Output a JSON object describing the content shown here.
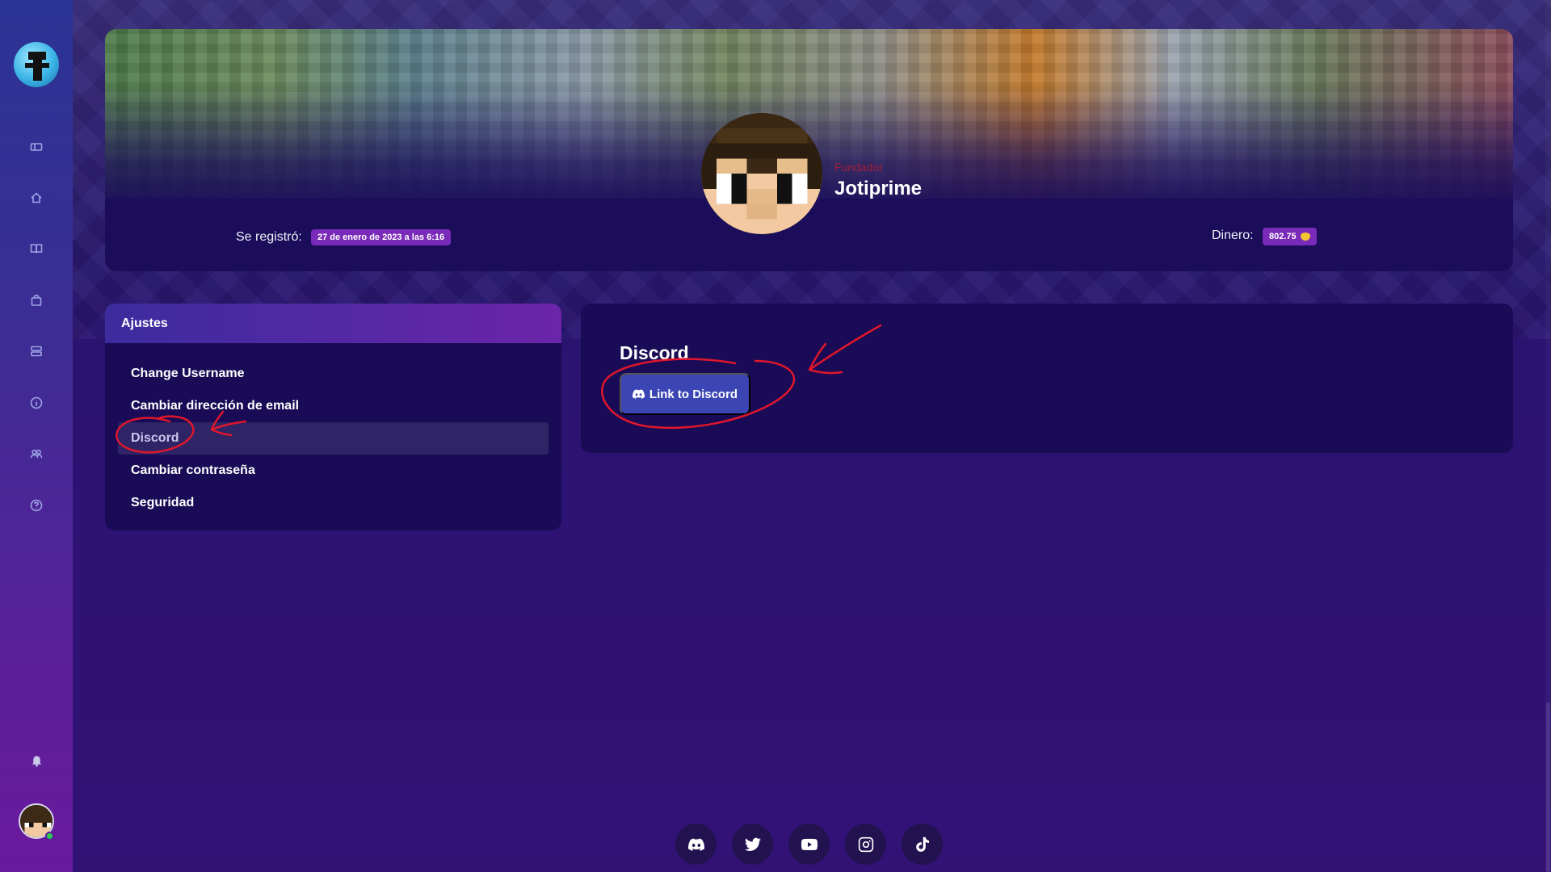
{
  "sidebar": {
    "nav_icons": [
      "ticket-icon",
      "home-icon",
      "book-icon",
      "shopping-bag-icon",
      "server-icon",
      "info-icon",
      "users-icon",
      "help-icon"
    ],
    "bell_icon": "bell-icon"
  },
  "profile": {
    "rank": "Fundador",
    "username": "Jotiprime",
    "registered_label": "Se registró:",
    "registered_value": "27 de enero de 2023 a las 6:16",
    "money_label": "Dinero:",
    "money_value": "802.75"
  },
  "settings": {
    "title": "Ajustes",
    "items": [
      {
        "label": "Change Username"
      },
      {
        "label": "Cambiar dirección de email"
      },
      {
        "label": "Discord",
        "active": true
      },
      {
        "label": "Cambiar contraseña"
      },
      {
        "label": "Seguridad"
      }
    ]
  },
  "discord": {
    "title": "Discord",
    "button_label": "Link to Discord"
  },
  "footer": {
    "socials": [
      "discord-icon",
      "twitter-icon",
      "youtube-icon",
      "instagram-icon",
      "tiktok-icon"
    ]
  },
  "colors": {
    "accent": "#7a2ab8",
    "discord_button": "#3b45b3",
    "annotation": "#e0162b"
  }
}
